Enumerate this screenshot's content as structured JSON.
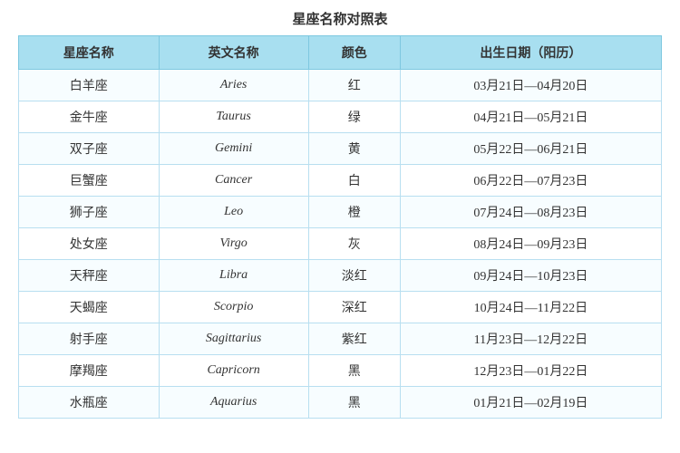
{
  "title": "星座名称对照表",
  "headers": [
    "星座名称",
    "英文名称",
    "颜色",
    "出生日期（阳历）"
  ],
  "rows": [
    {
      "chinese": "白羊座",
      "english": "Aries",
      "color": "红",
      "dates": "03月21日—04月20日"
    },
    {
      "chinese": "金牛座",
      "english": "Taurus",
      "color": "绿",
      "dates": "04月21日—05月21日"
    },
    {
      "chinese": "双子座",
      "english": "Gemini",
      "color": "黄",
      "dates": "05月22日—06月21日"
    },
    {
      "chinese": "巨蟹座",
      "english": "Cancer",
      "color": "白",
      "dates": "06月22日—07月23日"
    },
    {
      "chinese": "狮子座",
      "english": "Leo",
      "color": "橙",
      "dates": "07月24日—08月23日"
    },
    {
      "chinese": "处女座",
      "english": "Virgo",
      "color": "灰",
      "dates": "08月24日—09月23日"
    },
    {
      "chinese": "天秤座",
      "english": "Libra",
      "color": "淡红",
      "dates": "09月24日—10月23日"
    },
    {
      "chinese": "天蝎座",
      "english": "Scorpio",
      "color": "深红",
      "dates": "10月24日—11月22日"
    },
    {
      "chinese": "射手座",
      "english": "Sagittarius",
      "color": "紫红",
      "dates": "11月23日—12月22日"
    },
    {
      "chinese": "摩羯座",
      "english": "Capricorn",
      "color": "黑",
      "dates": "12月23日—01月22日"
    },
    {
      "chinese": "水瓶座",
      "english": "Aquarius",
      "color": "黑",
      "dates": "01月21日—02月19日"
    }
  ]
}
